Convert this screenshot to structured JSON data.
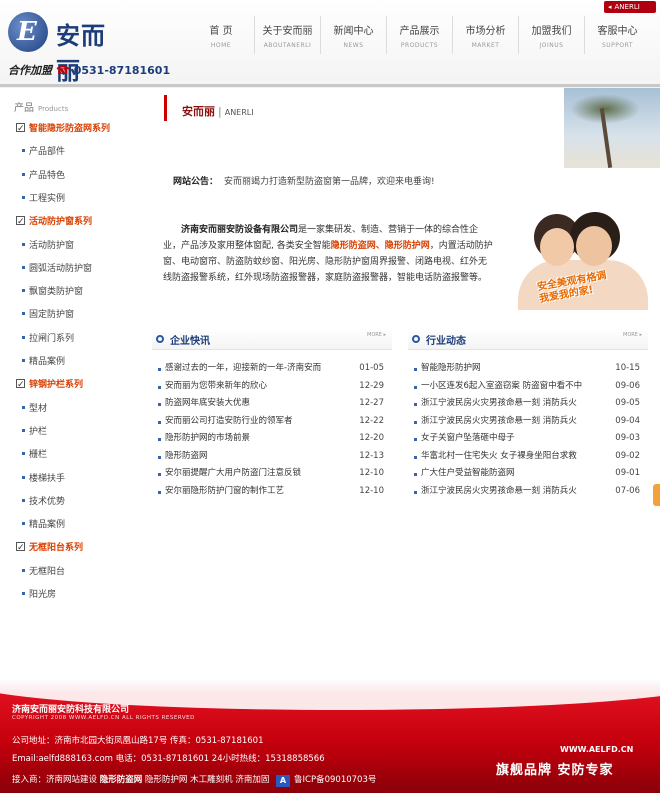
{
  "header": {
    "logo_letter": "E",
    "logo_text": "安而丽",
    "lang_tag": "ANERLI",
    "contact_label": "合作加盟",
    "phone": "0531-87181601",
    "nav": [
      {
        "cn": "首 页",
        "en": "HOME"
      },
      {
        "cn": "关于安而丽",
        "en": "ABOUTANERLI"
      },
      {
        "cn": "新闻中心",
        "en": "NEWS"
      },
      {
        "cn": "产品展示",
        "en": "PRODUCTS"
      },
      {
        "cn": "市场分析",
        "en": "MARKET"
      },
      {
        "cn": "加盟我们",
        "en": "JOINUS"
      },
      {
        "cn": "客服中心",
        "en": "SUPPORT"
      }
    ]
  },
  "sidebar": {
    "title": "产品",
    "title_en": "Products",
    "items": [
      {
        "type": "cat",
        "label": "智能隐形防盗网系列"
      },
      {
        "type": "sub",
        "label": "产品部件"
      },
      {
        "type": "sub",
        "label": "产品特色"
      },
      {
        "type": "sub",
        "label": "工程实例"
      },
      {
        "type": "cat",
        "label": "活动防护窗系列"
      },
      {
        "type": "sub",
        "label": "活动防护窗"
      },
      {
        "type": "sub",
        "label": "圆弧活动防护窗"
      },
      {
        "type": "sub",
        "label": "飘窗类防护窗"
      },
      {
        "type": "sub",
        "label": "固定防护窗"
      },
      {
        "type": "sub",
        "label": "拉闸门系列"
      },
      {
        "type": "sub",
        "label": "精品案例"
      },
      {
        "type": "cat",
        "label": "锌钢护栏系列"
      },
      {
        "type": "sub",
        "label": "型材"
      },
      {
        "type": "sub",
        "label": "护栏"
      },
      {
        "type": "sub",
        "label": "栅栏"
      },
      {
        "type": "sub",
        "label": "楼梯扶手"
      },
      {
        "type": "sub",
        "label": "技术优势"
      },
      {
        "type": "sub",
        "label": "精品案例"
      },
      {
        "type": "cat",
        "label": "无框阳台系列"
      },
      {
        "type": "sub",
        "label": "无框阳台"
      },
      {
        "type": "sub",
        "label": "阳光房"
      }
    ]
  },
  "main": {
    "title": "安而丽",
    "title_sep": "|",
    "title_en": "ANERLI",
    "notice_label": "网站公告：",
    "notice_text": "安而丽竭力打造新型防盗窗第一品牌，欢迎来电垂询!",
    "intro_company": "济南安而丽安防设备有限公司",
    "intro_p1": "是一家集研发、制造、营销于一体的综合性企业，产品涉及家用整体窗配, 各类安全智能",
    "intro_hl1": "隐形防盗网",
    "intro_comma": "、",
    "intro_hl2": "隐形防护网",
    "intro_p2": "，内置活动防护窗、电动窗帘、防盗防蚊纱窗、阳光房、隐形防护窗周界报警、闭路电视、红外无线防盗报警系统，红外现场防盗报警器，家庭防盗报警器，智能电话防盗报警等。",
    "photo_caption_1": "安全美观有格调",
    "photo_caption_2": "我爱我的家!"
  },
  "news_left": {
    "title": "企业快讯",
    "more": "MORE ▸",
    "items": [
      {
        "title": "感谢过去的一年，迎接新的一年-济南安而",
        "date": "01-05"
      },
      {
        "title": "安而丽为您带来新年的欣心",
        "date": "12-29"
      },
      {
        "title": "防盗网年底安装大优惠",
        "date": "12-27"
      },
      {
        "title": "安而丽公司打造安防行业的领军者",
        "date": "12-22"
      },
      {
        "title": "隐形防护网的市场前景",
        "date": "12-20"
      },
      {
        "title": "隐形防盗网",
        "date": "12-13"
      },
      {
        "title": "安尔丽提醒广大用户防盗门注意反锁",
        "date": "12-10"
      },
      {
        "title": "安尔丽隐形防护门窗的制作工艺",
        "date": "12-10"
      }
    ]
  },
  "news_right": {
    "title": "行业动态",
    "more": "MORE ▸",
    "items": [
      {
        "title": "智能隐形防护网",
        "date": "10-15"
      },
      {
        "title": "一小区连发6起入室盗窃案 防盗窗中看不中",
        "date": "09-06"
      },
      {
        "title": "浙江宁波民房火灾男孩命悬一刻 消防兵火",
        "date": "09-05"
      },
      {
        "title": "浙江宁波民房火灾男孩命悬一刻 消防兵火",
        "date": "09-04"
      },
      {
        "title": "女子关窗户坠落砸中母子",
        "date": "09-03"
      },
      {
        "title": "华富北村一住宅失火 女子裸身坐阳台求救",
        "date": "09-02"
      },
      {
        "title": "广大住户受益智能防盗网",
        "date": "09-01"
      },
      {
        "title": "浙江宁波民房火灾男孩命悬一刻 消防兵火",
        "date": "07-06"
      }
    ]
  },
  "footer": {
    "company": "济南安而丽安防科技有限公司",
    "copyright": "COPYRIGHT 2008 WWW.AELFD.CN ALL RIGHTS RESERVED",
    "address": "公司地址：济南市北园大街凤凰山路17号 传真：0531-87181601",
    "contact": "Email:aelfd888163.com 电话：0531-87181601 24小时热线：15318858566",
    "links_prefix": "接入商：济南网站建设 ",
    "link_bold": "隐形防盗网",
    "links_rest": " 隐形防护网 木工雕刻机 济南加固 ",
    "link_icon": "A",
    "icp": "鲁ICP备09010703号",
    "url": "WWW.AELFD.CN",
    "slogan": "旗舰品牌 安防专家"
  }
}
